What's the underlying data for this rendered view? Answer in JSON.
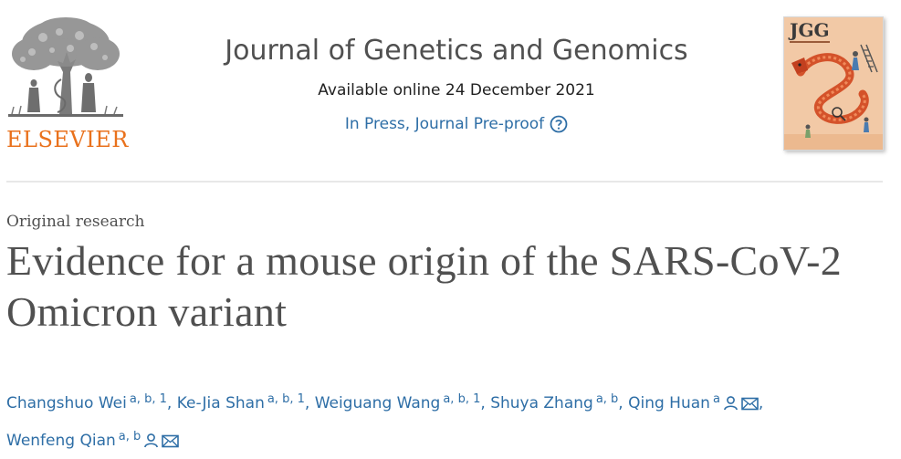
{
  "publisher": {
    "logo_text": "ELSEVIER"
  },
  "journal": {
    "title": "Journal of Genetics and Genomics",
    "availability": "Available online 24 December 2021",
    "status": "In Press, Journal Pre-proof",
    "cover_abbrev": "JGG"
  },
  "article": {
    "type": "Original research",
    "title": "Evidence for a mouse origin of the SARS-CoV-2 Omicron variant",
    "authors": [
      {
        "name": "Changshuo Wei",
        "affil": "a, b, 1",
        "separator": ","
      },
      {
        "name": "Ke-Jia Shan",
        "affil": "a, b, 1",
        "separator": ","
      },
      {
        "name": "Weiguang Wang",
        "affil": "a, b, 1",
        "separator": ","
      },
      {
        "name": "Shuya Zhang",
        "affil": "a, b",
        "separator": ","
      },
      {
        "name": "Qing Huan",
        "affil": "a",
        "separator": ","
      },
      {
        "name": "Wenfeng Qian",
        "affil": "a, b",
        "separator": ""
      }
    ]
  },
  "colors": {
    "link": "#2e6ea6",
    "elsevier_orange": "#e9711c",
    "title_gray": "#505050"
  },
  "icons": [
    "elsevier-tree-logo",
    "help-icon",
    "person-icon",
    "envelope-icon"
  ]
}
